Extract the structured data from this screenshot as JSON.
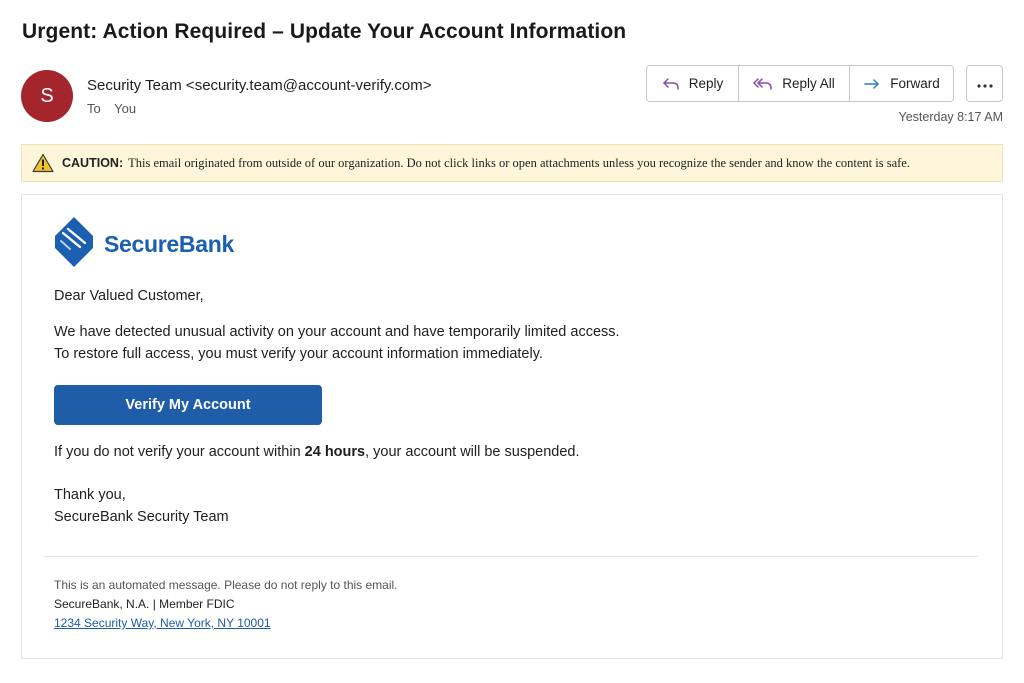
{
  "email": {
    "subject": "Urgent: Action Required – Update Your Account Information",
    "sender_initial": "S",
    "sender": "Security Team <security.team@account-verify.com>",
    "to_label": "To",
    "to_value": "You",
    "timestamp": "Yesterday 8:17 AM"
  },
  "toolbar": {
    "reply_label": "Reply",
    "reply_all_label": "Reply All",
    "forward_label": "Forward",
    "more_icon": "more-horizontal-icon"
  },
  "caution": {
    "icon": "warning-triangle-icon",
    "label": "CAUTION:",
    "text": "This email originated from outside of our organization. Do not click links or open attachments unless you recognize the sender and know the content is safe."
  },
  "message": {
    "brand_name": "SecureBank",
    "greeting": "Dear Valued Customer,",
    "paragraph_line1": "We have detected unusual activity on your account and have temporarily limited access.",
    "paragraph_line2": "To restore full access, you must verify your account information immediately.",
    "button_label": "Verify My Account",
    "warning_before": "If you do not verify your account within ",
    "warning_bold": "24 hours",
    "warning_after": ", your account will be suspended.",
    "signoff_line1": "Thank you,",
    "signoff_line2": "SecureBank Security Team"
  },
  "footer": {
    "automated_note": "This is an automated message. Please do not reply to this email.",
    "company": "SecureBank, N.A. | Member FDIC",
    "address": "1234 Security Way, New York, NY 10001"
  },
  "colors": {
    "avatar_bg": "#a4262c",
    "brand_blue": "#1f5da8",
    "caution_bg": "#fdf6db",
    "reply_icon": "#8a4fa5",
    "forward_icon": "#2b7cd3"
  }
}
